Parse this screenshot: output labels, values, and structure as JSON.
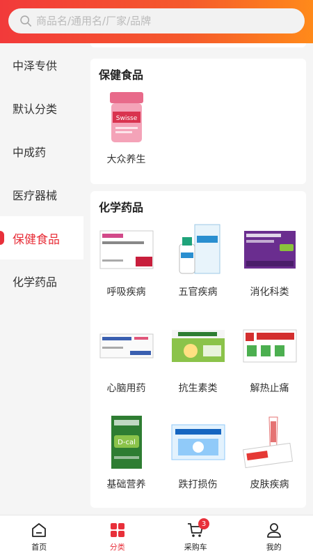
{
  "search": {
    "placeholder": "商品名/通用名/厂家/品牌"
  },
  "sidebar": {
    "items": [
      {
        "label": "中泽专供"
      },
      {
        "label": "默认分类"
      },
      {
        "label": "中成药"
      },
      {
        "label": "医疗器械"
      },
      {
        "label": "保健食品"
      },
      {
        "label": "化学药品"
      }
    ],
    "active_index": 4
  },
  "sections": {
    "health_food": {
      "title": "保健食品",
      "items": [
        {
          "label": "大众养生",
          "icon": "supplement-jar-icon"
        }
      ]
    },
    "chemical": {
      "title": "化学药品",
      "items": [
        {
          "label": "呼吸疾病",
          "icon": "inhaler-box-icon"
        },
        {
          "label": "五官疾病",
          "icon": "eye-drop-box-icon"
        },
        {
          "label": "消化科类",
          "icon": "purple-box-icon"
        },
        {
          "label": "心脑用药",
          "icon": "white-box-icon"
        },
        {
          "label": "抗生素类",
          "icon": "green-granule-box-icon"
        },
        {
          "label": "解热止痛",
          "icon": "capsule-box-icon"
        },
        {
          "label": "基础营养",
          "icon": "calcium-box-icon"
        },
        {
          "label": "跌打损伤",
          "icon": "spray-box-icon"
        },
        {
          "label": "皮肤疾病",
          "icon": "ointment-tube-icon"
        }
      ]
    }
  },
  "tabbar": {
    "home": "首页",
    "category": "分类",
    "cart": "采购车",
    "cart_badge": "3",
    "mine": "我的"
  },
  "colors": {
    "accent": "#e8303a",
    "header_start": "#f23a3a",
    "header_end": "#ff8a1a"
  }
}
